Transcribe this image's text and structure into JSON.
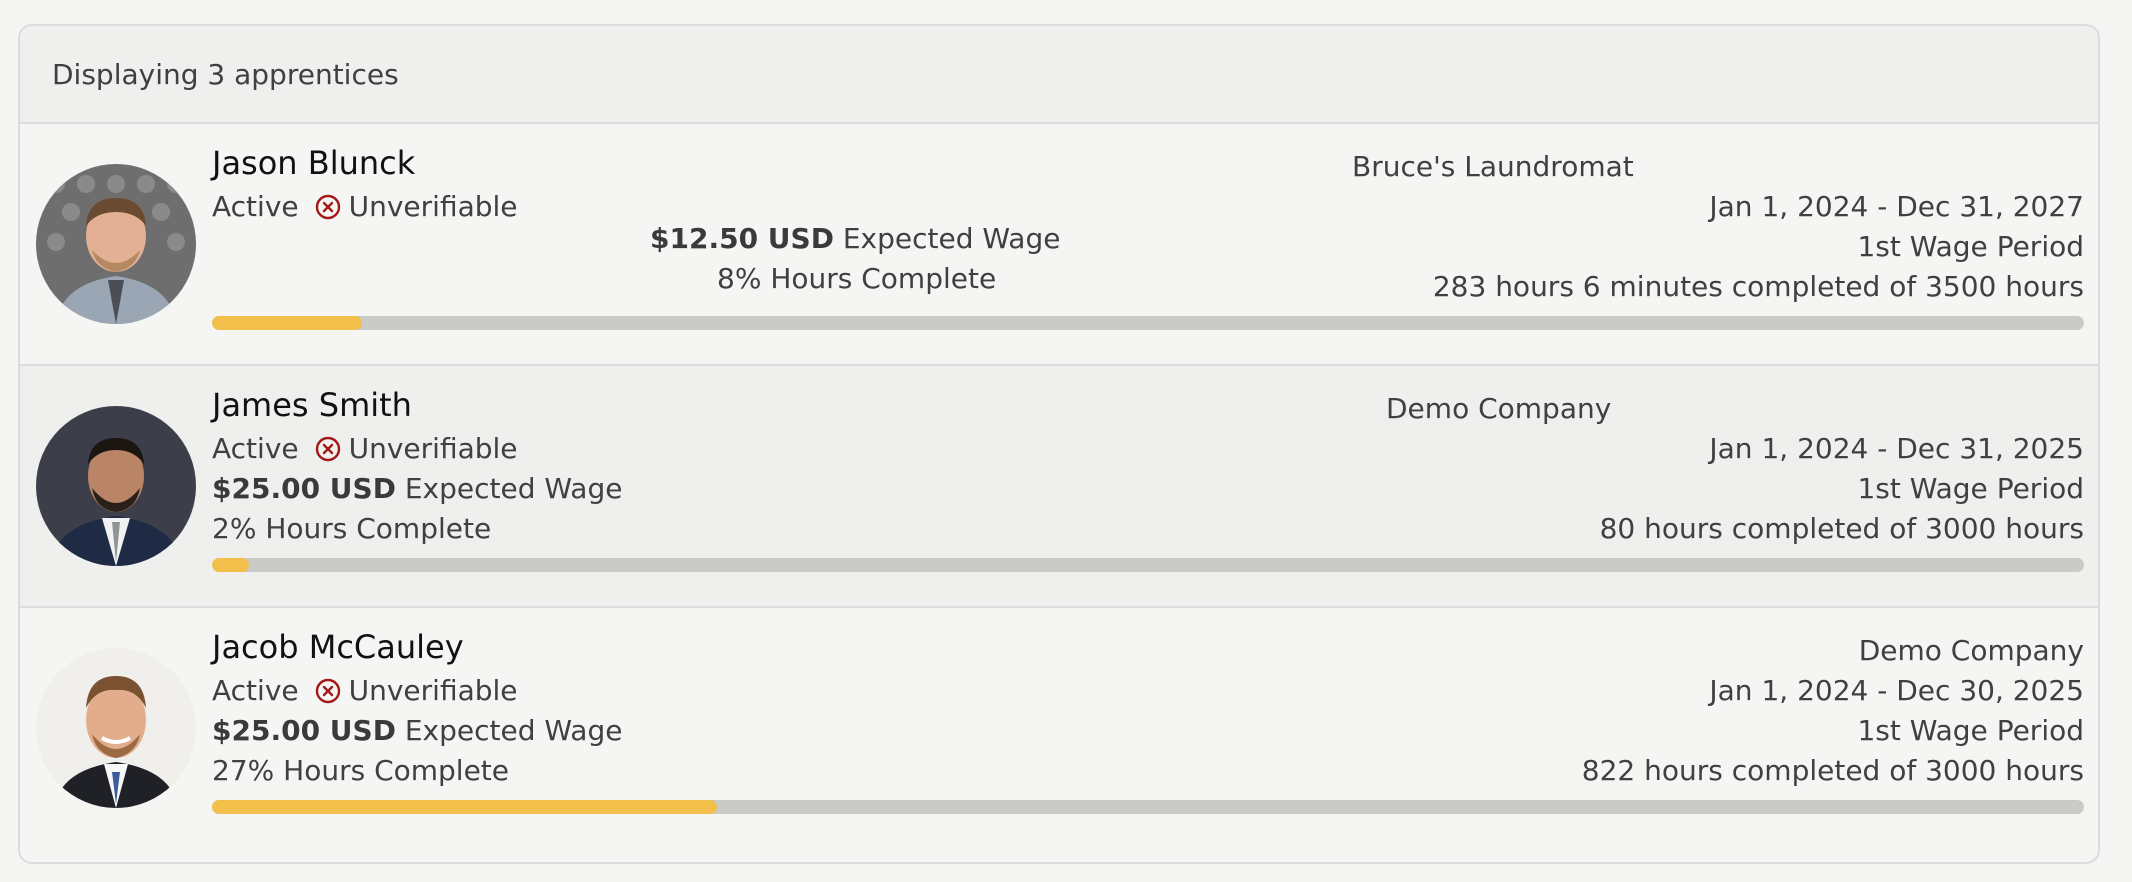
{
  "header": {
    "count_text": "Displaying 3 apprentices"
  },
  "apprentices": [
    {
      "name": "Jason Blunck",
      "status": "Active",
      "verification": "Unverifiable",
      "wage_amount": "$12.50 USD",
      "wage_label": "Expected Wage",
      "hours_pct_text": "8% Hours Complete",
      "progress": 0.08,
      "company": "Bruce's Laundromat",
      "date_range": "Jan 1, 2024 - Dec 31, 2027",
      "wage_period": "1st Wage Period",
      "hours_text": "283 hours 6 minutes completed of 3500 hours"
    },
    {
      "name": "James Smith",
      "status": "Active",
      "verification": "Unverifiable",
      "wage_amount": "$25.00 USD",
      "wage_label": "Expected Wage",
      "hours_pct_text": "2% Hours Complete",
      "progress": 0.02,
      "company": "Demo Company",
      "date_range": "Jan 1, 2024 - Dec 31, 2025",
      "wage_period": "1st Wage Period",
      "hours_text": "80 hours completed of 3000 hours"
    },
    {
      "name": "Jacob McCauley",
      "status": "Active",
      "verification": "Unverifiable",
      "wage_amount": "$25.00 USD",
      "wage_label": "Expected Wage",
      "hours_pct_text": "27% Hours Complete",
      "progress": 0.27,
      "company": "Demo Company",
      "date_range": "Jan 1, 2024 - Dec 30, 2025",
      "wage_period": "1st Wage Period",
      "hours_text": "822 hours completed of 3000 hours"
    }
  ],
  "colors": {
    "progress_fill": "#f2c04a",
    "progress_track": "#cacac8",
    "unverifiable_icon": "#a01818"
  },
  "icons": {
    "verification": "x-circle-icon"
  }
}
